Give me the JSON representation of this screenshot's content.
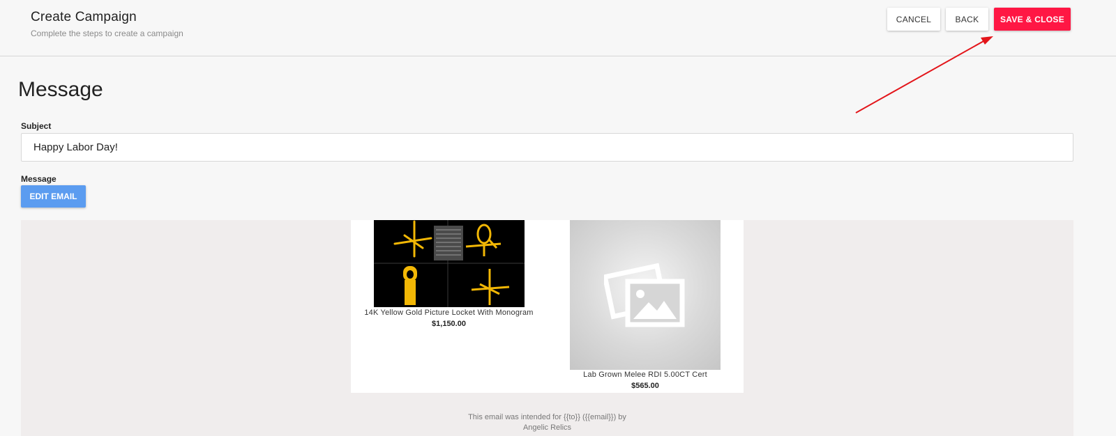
{
  "header": {
    "title": "Create Campaign",
    "subtitle": "Complete the steps to create a campaign",
    "buttons": {
      "cancel": "CANCEL",
      "back": "BACK",
      "save_close": "SAVE & CLOSE"
    }
  },
  "colors": {
    "save_button": "#ff1744",
    "edit_button": "#5b9cf0",
    "annotation_arrow": "#e3151a"
  },
  "section": {
    "title": "Message"
  },
  "form": {
    "subject_label": "Subject",
    "subject_value": "Happy Labor Day!",
    "message_label": "Message",
    "edit_email_label": "EDIT EMAIL"
  },
  "email_preview": {
    "products": [
      {
        "name": "14K Yellow Gold Picture Locket With Monogram",
        "price": "$1,150.00",
        "image": "cad-render-thumbnail"
      },
      {
        "name": "Lab Grown Melee RDI 5.00CT Cert",
        "price": "$565.00",
        "image": "placeholder-image-icon"
      }
    ],
    "footer_lines": [
      "This email was intended for {{to}} ({{email}}) by",
      "Angelic Relics"
    ]
  }
}
